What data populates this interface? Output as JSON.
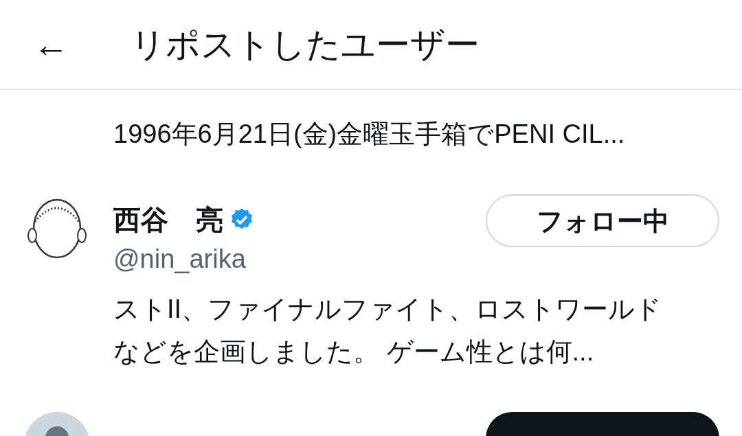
{
  "header": {
    "back": "←",
    "title": "リポストしたユーザー"
  },
  "users": [
    {
      "bio": [
        "1996年6月21日(金)金曜玉手箱でPENI CIL..."
      ]
    },
    {
      "kind": "drawing",
      "name": "西谷　亮",
      "verified": true,
      "handle": "@nin_arika",
      "following": true,
      "button": "フォロー中",
      "bio": [
        "ストII、ファイナルファイト、ロストワールド",
        "などを企画しました。 ゲーム性とは何..."
      ]
    },
    {
      "kind": "silhouette",
      "following": false
    }
  ]
}
